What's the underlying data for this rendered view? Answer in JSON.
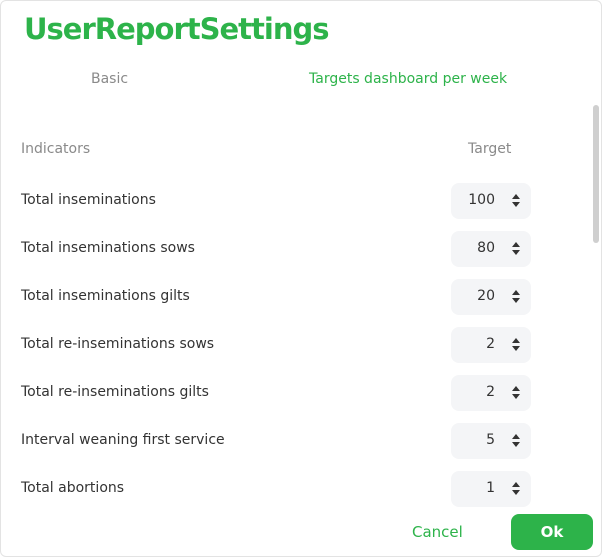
{
  "dialog": {
    "title": "UserReportSettings"
  },
  "tabs": [
    {
      "label": "Basic",
      "active": false
    },
    {
      "label": "Targets dashboard per week",
      "active": true
    }
  ],
  "table": {
    "headers": {
      "indicators": "Indicators",
      "target": "Target"
    },
    "rows": [
      {
        "label": "Total inseminations",
        "value": "100"
      },
      {
        "label": "Total inseminations sows",
        "value": "80"
      },
      {
        "label": "Total inseminations gilts",
        "value": "20"
      },
      {
        "label": "Total re-inseminations sows",
        "value": "2"
      },
      {
        "label": "Total re-inseminations gilts",
        "value": "2"
      },
      {
        "label": "Interval weaning first service",
        "value": "5"
      },
      {
        "label": "Total abortions",
        "value": "1"
      }
    ]
  },
  "footer": {
    "cancel_label": "Cancel",
    "ok_label": "Ok"
  },
  "colors": {
    "accent": "#2db34a",
    "muted": "#8a8a8a",
    "text": "#333333",
    "stepper_bg": "#f4f5f7"
  }
}
